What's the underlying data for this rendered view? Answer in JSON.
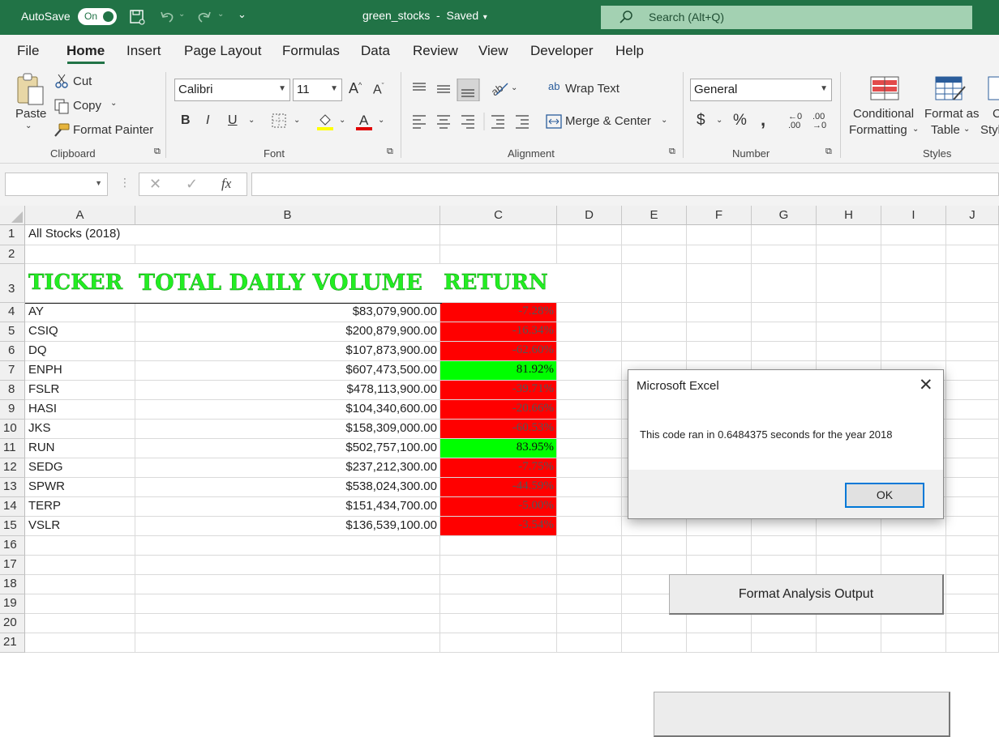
{
  "titlebar": {
    "autosave_label": "AutoSave",
    "autosave_state": "On",
    "filename": "green_stocks",
    "save_state": "Saved",
    "search_placeholder": "Search (Alt+Q)"
  },
  "menu": [
    "File",
    "Home",
    "Insert",
    "Page Layout",
    "Formulas",
    "Data",
    "Review",
    "View",
    "Developer",
    "Help"
  ],
  "ribbon": {
    "paste": "Paste",
    "cut": "Cut",
    "copy": "Copy",
    "format_painter": "Format Painter",
    "font_name": "Calibri",
    "font_size": "11",
    "wrap_text": "Wrap Text",
    "merge_center": "Merge & Center",
    "number_format": "General",
    "conditional_formatting_1": "Conditional",
    "conditional_formatting_2": "Formatting",
    "format_table_1": "Format as",
    "format_table_2": "Table",
    "cell_styles_1": "C",
    "cell_styles_2": "Styl",
    "groups": {
      "clipboard": "Clipboard",
      "font": "Font",
      "alignment": "Alignment",
      "number": "Number",
      "styles": "Styles"
    }
  },
  "formula_bar": {
    "name_box": "",
    "fx": "fx",
    "formula": ""
  },
  "sheet": {
    "columns": [
      "A",
      "B",
      "C",
      "D",
      "E",
      "F",
      "G",
      "H",
      "I",
      "J"
    ],
    "rows": [
      "1",
      "2",
      "3",
      "4",
      "5",
      "6",
      "7",
      "8",
      "9",
      "10",
      "11",
      "12",
      "13",
      "14",
      "15",
      "16",
      "17",
      "18",
      "19",
      "20",
      "21"
    ],
    "title": "All Stocks (2018)",
    "headers": [
      "TICKER",
      "TOTAL DAILY VOLUME",
      "RETURN"
    ],
    "data": [
      {
        "ticker": "AY",
        "volume": "$83,079,900.00",
        "return": "-7.28%",
        "positive": false
      },
      {
        "ticker": "CSIQ",
        "volume": "$200,879,900.00",
        "return": "-16.34%",
        "positive": false
      },
      {
        "ticker": "DQ",
        "volume": "$107,873,900.00",
        "return": "-62.60%",
        "positive": false
      },
      {
        "ticker": "ENPH",
        "volume": "$607,473,500.00",
        "return": "81.92%",
        "positive": true
      },
      {
        "ticker": "FSLR",
        "volume": "$478,113,900.00",
        "return": "-39.71%",
        "positive": false
      },
      {
        "ticker": "HASI",
        "volume": "$104,340,600.00",
        "return": "-20.66%",
        "positive": false
      },
      {
        "ticker": "JKS",
        "volume": "$158,309,000.00",
        "return": "-60.53%",
        "positive": false
      },
      {
        "ticker": "RUN",
        "volume": "$502,757,100.00",
        "return": "83.95%",
        "positive": true
      },
      {
        "ticker": "SEDG",
        "volume": "$237,212,300.00",
        "return": "-7.75%",
        "positive": false
      },
      {
        "ticker": "SPWR",
        "volume": "$538,024,300.00",
        "return": "-44.59%",
        "positive": false
      },
      {
        "ticker": "TERP",
        "volume": "$151,434,700.00",
        "return": "-5.00%",
        "positive": false
      },
      {
        "ticker": "VSLR",
        "volume": "$136,539,100.00",
        "return": "-3.54%",
        "positive": false
      }
    ],
    "format_button": "Format Analysis Output"
  },
  "dialog": {
    "title": "Microsoft Excel",
    "message": "This code ran in 0.6484375 seconds for the year 2018",
    "ok": "OK"
  },
  "colors": {
    "positive": "#00ff00",
    "negative": "#ff0000",
    "header_green": "#22ee22",
    "excel_green": "#217346"
  }
}
